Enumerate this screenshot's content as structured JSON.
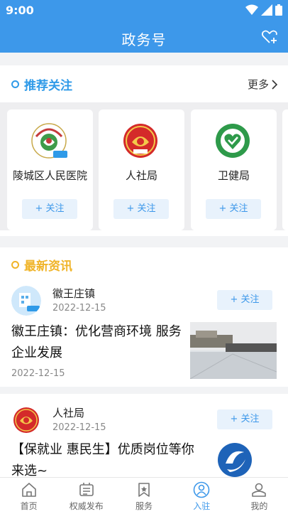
{
  "status": {
    "time": "9:00"
  },
  "header": {
    "title": "政务号"
  },
  "recommend": {
    "title": "推荐关注",
    "more": "更多",
    "accent": "#2f9ae8",
    "cards": [
      {
        "name": "陵城区人民医院",
        "follow": "+ 关注"
      },
      {
        "name": "人社局",
        "follow": "+ 关注"
      },
      {
        "name": "卫健局",
        "follow": "+ 关注"
      }
    ]
  },
  "latest": {
    "title": "最新资讯",
    "accent": "#f0b429",
    "items": [
      {
        "source": "徽王庄镇",
        "source_date": "2022-12-15",
        "follow": "+ 关注",
        "headline": "徽王庄镇：优化营商环境 服务企业发展",
        "publish_date": "2022-12-15"
      },
      {
        "source": "人社局",
        "source_date": "2022-12-15",
        "follow": "+ 关注",
        "headline": "【保就业 惠民生】优质岗位等你来选~"
      }
    ]
  },
  "tabs": [
    {
      "label": "首页",
      "icon": "home-icon"
    },
    {
      "label": "权威发布",
      "icon": "news-icon"
    },
    {
      "label": "服务",
      "icon": "bookmark-icon"
    },
    {
      "label": "入驻",
      "icon": "person-circle-icon",
      "active": true
    },
    {
      "label": "我的",
      "icon": "user-icon"
    }
  ],
  "colors": {
    "primary": "#3d98ea"
  }
}
